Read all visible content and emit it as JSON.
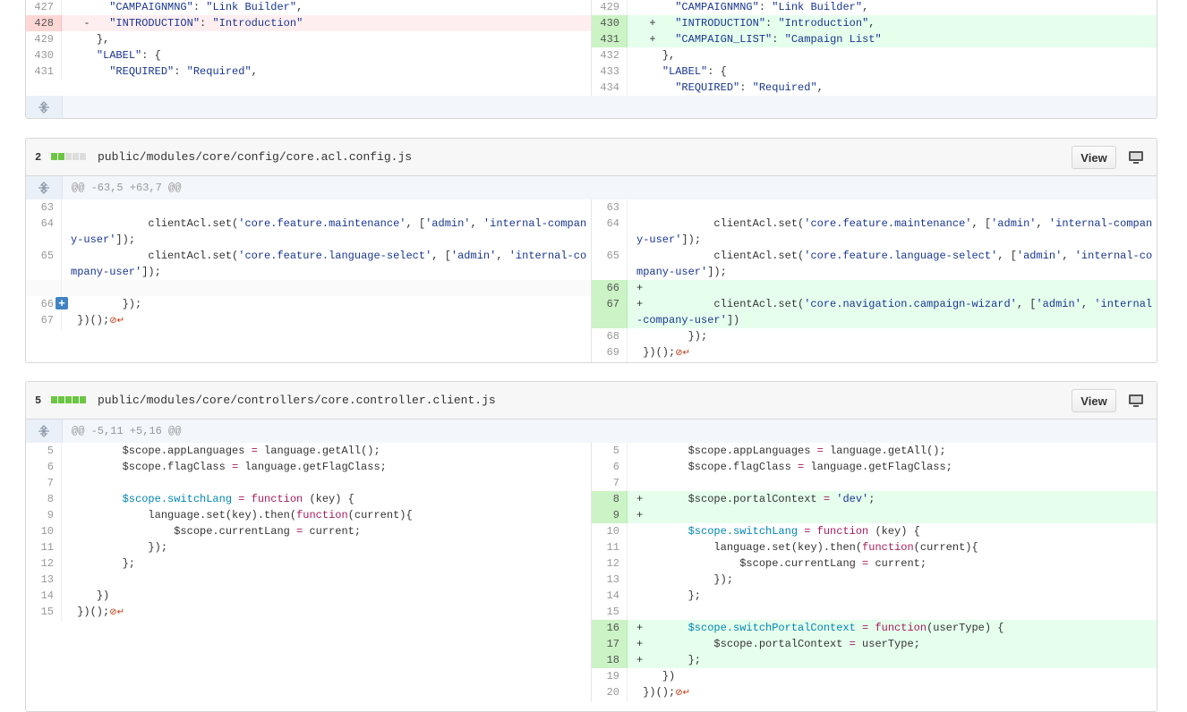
{
  "file1": {
    "left": [
      {
        "n": "427",
        "t": "c",
        "c": "      \"CAMPAIGNMNG\": \"Link Builder\","
      },
      {
        "n": "428",
        "t": "d",
        "c": "  -   \"INTRODUCTION\": \"Introduction\""
      },
      {
        "n": "",
        "t": "e",
        "c": ""
      },
      {
        "n": "429",
        "t": "c",
        "c": "    },"
      },
      {
        "n": "430",
        "t": "c",
        "c": "    \"LABEL\": {"
      },
      {
        "n": "431",
        "t": "c",
        "c": "      \"REQUIRED\": \"Required\","
      }
    ],
    "right": [
      {
        "n": "429",
        "t": "c",
        "c": "      \"CAMPAIGNMNG\": \"Link Builder\","
      },
      {
        "n": "430",
        "t": "a",
        "c": "  +   \"INTRODUCTION\": \"Introduction\","
      },
      {
        "n": "431",
        "t": "a",
        "c": "  +   \"CAMPAIGN_LIST\": \"Campaign List\""
      },
      {
        "n": "432",
        "t": "c",
        "c": "    },"
      },
      {
        "n": "433",
        "t": "c",
        "c": "    \"LABEL\": {"
      },
      {
        "n": "434",
        "t": "c",
        "c": "      \"REQUIRED\": \"Required\","
      }
    ]
  },
  "file2": {
    "stat": "2",
    "blocks": [
      1,
      1,
      0,
      0,
      0
    ],
    "path": "public/modules/core/config/core.acl.config.js",
    "view_label": "View",
    "hunk": "@@ -63,5 +63,7 @@",
    "left": [
      {
        "n": "63",
        "t": "c",
        "c": ""
      },
      {
        "n": "64",
        "t": "c",
        "c": "            clientAcl.set('core.feature.maintenance', ['admin', 'internal-company-user']);"
      },
      {
        "n": "65",
        "t": "c",
        "c": "            clientAcl.set('core.feature.language-select', ['admin', 'internal-company-user']);"
      },
      {
        "n": "",
        "t": "e",
        "c": ""
      },
      {
        "n": "",
        "t": "e",
        "c": "\n"
      },
      {
        "n": "66",
        "t": "c",
        "c": "        });",
        "badge": "+"
      },
      {
        "n": "67",
        "t": "c",
        "c": " })();",
        "eol": "⊘↵"
      }
    ],
    "right": [
      {
        "n": "63",
        "t": "c",
        "c": ""
      },
      {
        "n": "64",
        "t": "c",
        "c": "            clientAcl.set('core.feature.maintenance', ['admin', 'internal-company-user']);"
      },
      {
        "n": "65",
        "t": "c",
        "c": "            clientAcl.set('core.feature.language-select', ['admin', 'internal-company-user']);"
      },
      {
        "n": "66",
        "t": "a",
        "c": "+"
      },
      {
        "n": "67",
        "t": "a",
        "c": "+           clientAcl.set('core.navigation.campaign-wizard', ['admin', 'internal-company-user'])"
      },
      {
        "n": "68",
        "t": "c",
        "c": "        });"
      },
      {
        "n": "69",
        "t": "c",
        "c": " })();",
        "eol": "⊘↵"
      }
    ]
  },
  "file3": {
    "stat": "5",
    "blocks": [
      1,
      1,
      1,
      1,
      1
    ],
    "path": "public/modules/core/controllers/core.controller.client.js",
    "view_label": "View",
    "hunk": "@@ -5,11 +5,16 @@",
    "left": [
      {
        "n": "5",
        "t": "c",
        "c": "        $scope.appLanguages = language.getAll();"
      },
      {
        "n": "6",
        "t": "c",
        "c": "        $scope.flagClass = language.getFlagClass;"
      },
      {
        "n": "7",
        "t": "c",
        "c": ""
      },
      {
        "n": "",
        "t": "e",
        "c": ""
      },
      {
        "n": "",
        "t": "e",
        "c": ""
      },
      {
        "n": "8",
        "t": "c",
        "c": "        $scope.switchLang = function (key) {"
      },
      {
        "n": "9",
        "t": "c",
        "c": "            language.set(key).then(function(current){"
      },
      {
        "n": "10",
        "t": "c",
        "c": "                $scope.currentLang = current;"
      },
      {
        "n": "11",
        "t": "c",
        "c": "            });"
      },
      {
        "n": "12",
        "t": "c",
        "c": "        };"
      },
      {
        "n": "13",
        "t": "c",
        "c": ""
      },
      {
        "n": "",
        "t": "e",
        "c": ""
      },
      {
        "n": "",
        "t": "e",
        "c": ""
      },
      {
        "n": "",
        "t": "e",
        "c": ""
      },
      {
        "n": "14",
        "t": "c",
        "c": "    })"
      },
      {
        "n": "15",
        "t": "c",
        "c": " })();",
        "eol": "⊘↵"
      }
    ],
    "right": [
      {
        "n": "5",
        "t": "c",
        "c": "        $scope.appLanguages = language.getAll();"
      },
      {
        "n": "6",
        "t": "c",
        "c": "        $scope.flagClass = language.getFlagClass;"
      },
      {
        "n": "7",
        "t": "c",
        "c": ""
      },
      {
        "n": "8",
        "t": "a",
        "c": "+       $scope.portalContext = 'dev';"
      },
      {
        "n": "9",
        "t": "a",
        "c": "+"
      },
      {
        "n": "10",
        "t": "c",
        "c": "        $scope.switchLang = function (key) {"
      },
      {
        "n": "11",
        "t": "c",
        "c": "            language.set(key).then(function(current){"
      },
      {
        "n": "12",
        "t": "c",
        "c": "                $scope.currentLang = current;"
      },
      {
        "n": "13",
        "t": "c",
        "c": "            });"
      },
      {
        "n": "14",
        "t": "c",
        "c": "        };"
      },
      {
        "n": "15",
        "t": "c",
        "c": ""
      },
      {
        "n": "16",
        "t": "a",
        "c": "+       $scope.switchPortalContext = function(userType) {"
      },
      {
        "n": "17",
        "t": "a",
        "c": "+           $scope.portalContext = userType;"
      },
      {
        "n": "18",
        "t": "a",
        "c": "+       };"
      },
      {
        "n": "19",
        "t": "c",
        "c": "    })"
      },
      {
        "n": "20",
        "t": "c",
        "c": " })();",
        "eol": "⊘↵"
      }
    ]
  }
}
